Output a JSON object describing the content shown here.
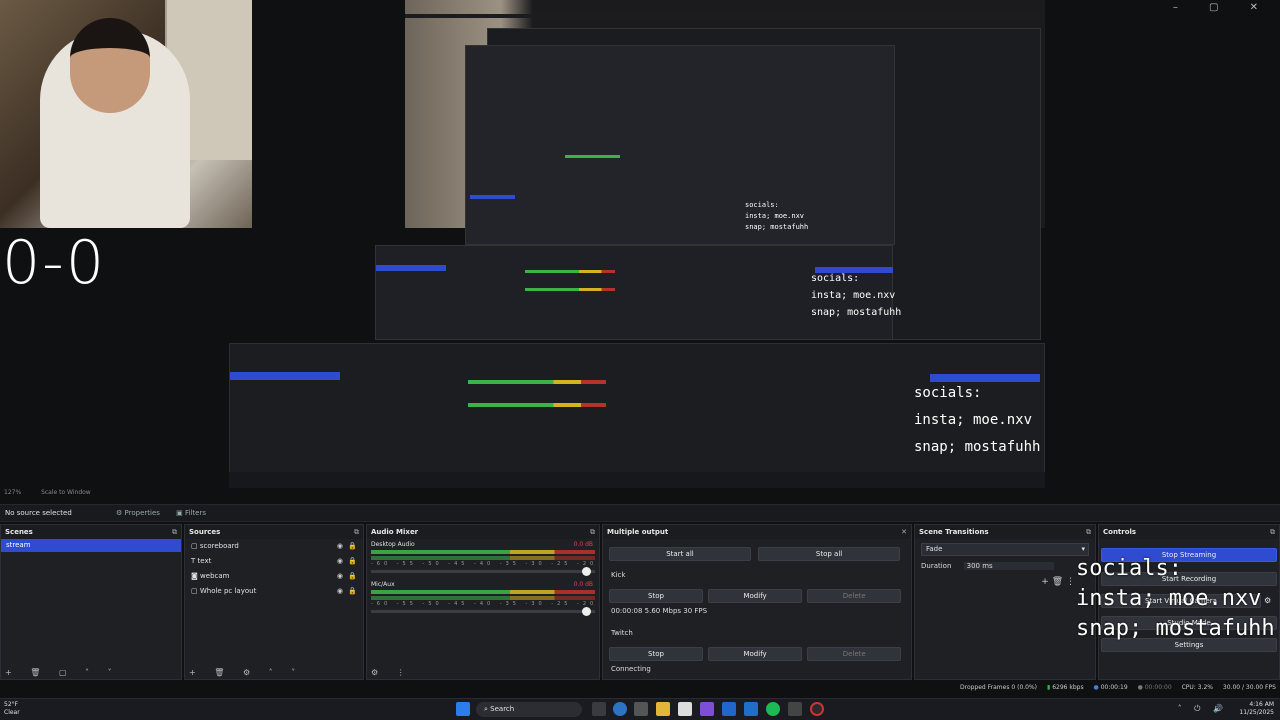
{
  "score": "0-0",
  "window_controls": "–  ▢  ✕",
  "toolbar": {
    "zoom": "127%",
    "scale": "Scale to Window"
  },
  "source_bar": {
    "status": "No source selected",
    "properties": "Properties",
    "filters": "Filters"
  },
  "scenes": {
    "title": "Scenes",
    "items": [
      "stream"
    ]
  },
  "sources": {
    "title": "Sources",
    "items": [
      "scoreboard",
      "text",
      "webcam",
      "Whole pc layout"
    ]
  },
  "mixer": {
    "title": "Audio Mixer",
    "channels": [
      {
        "name": "Desktop Audio",
        "db": "0.0 dB"
      },
      {
        "name": "Mic/Aux",
        "db": "0.0 dB"
      }
    ],
    "ticks": "-60 -55 -50 -45 -40 -35 -30 -25 -20 -15 -10 -5 0"
  },
  "multi_output": {
    "title": "Multiple output",
    "start_all": "Start all",
    "stop_all": "Stop all",
    "targets": [
      {
        "name": "Kick",
        "stop": "Stop",
        "modify": "Modify",
        "delete": "Delete",
        "stats": "00:00:08  5.60 Mbps  30 FPS"
      },
      {
        "name": "Twitch",
        "stop": "Stop",
        "modify": "Modify",
        "delete": "Delete",
        "stats": "Connecting"
      }
    ]
  },
  "transitions": {
    "title": "Scene Transitions",
    "selected": "Fade",
    "duration_label": "Duration",
    "duration_value": "300 ms"
  },
  "controls": {
    "title": "Controls",
    "stop_streaming": "Stop Streaming",
    "start_recording": "Start Recording",
    "virtual_camera": "Start Virtual Camera",
    "studio_mode": "Studio Mode",
    "settings": "Settings"
  },
  "overlay": {
    "line1": "socials:",
    "line2": "insta; moe.nxv",
    "line3": "snap; mostafuhh"
  },
  "status": {
    "dropped": "Dropped Frames 0 (0.0%)",
    "bitrate": "6296 kbps",
    "stream_time": "00:00:19",
    "rec_time": "00:00:00",
    "cpu": "CPU: 3.2%",
    "fps": "30.00 / 30.00 FPS"
  },
  "taskbar": {
    "weather_temp": "52°F",
    "weather_desc": "Clear",
    "search": "Search",
    "time": "4:16 AM",
    "date": "11/25/2025"
  },
  "colors": {
    "accent": "#2f4bd0",
    "meter_green": "#3cb34a",
    "meter_yellow": "#d3b321",
    "meter_red": "#b5332b"
  }
}
